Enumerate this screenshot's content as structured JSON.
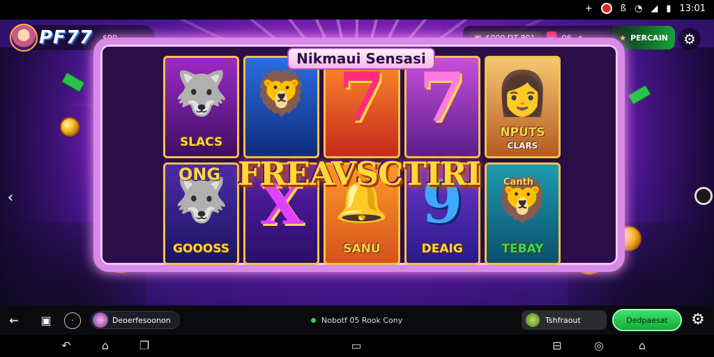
{
  "status_bar": {
    "plus": "+",
    "time": "13:01",
    "icon_b": "ß",
    "icon_wifi": "wifi-icon",
    "icon_signal": "signal-icon",
    "icon_battery": "battery-icon"
  },
  "header": {
    "brand": "PF77",
    "badge": "$90",
    "stats_left": "$000 DT 801",
    "stats_mid": "06",
    "stats_right": "PERCAIN",
    "settings_icon": "gear-icon"
  },
  "game": {
    "title": "Nikmaui Sensasi",
    "banner": "FREAVSCTIRI",
    "left_label": "ONG",
    "right_label": "Canth",
    "reels": [
      {
        "symbol": "🐺",
        "caption": "SLACS"
      },
      {
        "symbol": "🦁",
        "caption": ""
      },
      {
        "symbol": "7",
        "caption": ""
      },
      {
        "symbol": "7",
        "caption": ""
      },
      {
        "symbol": "👩",
        "caption": "NPUTS"
      },
      {
        "symbol": "🐺",
        "caption": "GOOOSS"
      },
      {
        "symbol": "X",
        "caption": ""
      },
      {
        "symbol": "🔔",
        "caption": "SANU"
      },
      {
        "symbol": "9",
        "caption": "DEAIG"
      },
      {
        "symbol": "🦁",
        "caption": "TEBAY"
      }
    ],
    "reel5_sub": "CLARS"
  },
  "action_bar": {
    "back_icon": "back-icon",
    "profile_label": "Deoerfesoonon",
    "status_text": "Nobotf 05 Rook Cony",
    "pill_label": "Tshfraout",
    "green_button": "Dedpaesat",
    "settings_icon": "gear-icon"
  },
  "colors": {
    "accent_green": "#17a83a",
    "frame_pink": "#d88ae8",
    "gold": "#ffd54a"
  }
}
